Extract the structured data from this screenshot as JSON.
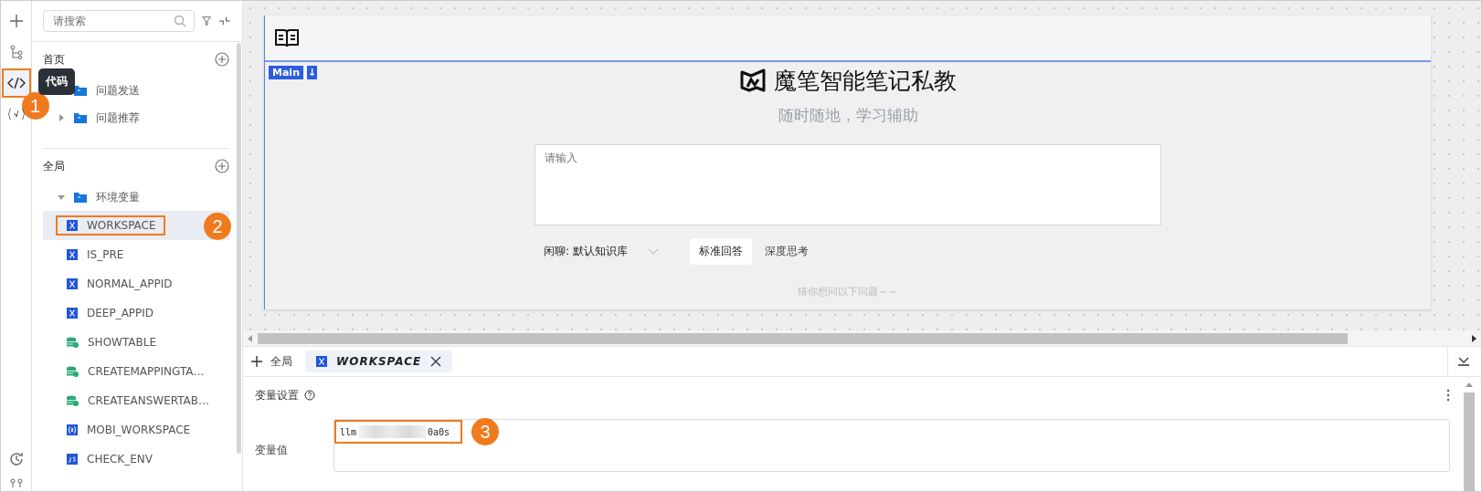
{
  "rail": {
    "items": [
      {
        "kind": "plus",
        "selected": false
      },
      {
        "kind": "tree",
        "selected": false
      },
      {
        "kind": "code",
        "selected": true,
        "callout": "1"
      },
      {
        "kind": "var",
        "selected": false
      }
    ],
    "bottom": [
      {
        "kind": "history"
      },
      {
        "kind": "branch"
      }
    ],
    "tooltip": "代码"
  },
  "sidebar": {
    "search": {
      "placeholder": "请搜索"
    },
    "sections": [
      {
        "title": "首页",
        "items": [
          {
            "label": "问题发送",
            "expanded": false
          },
          {
            "label": "问题推荐",
            "expanded": false
          }
        ]
      },
      {
        "title": "全局",
        "items": [
          {
            "label": "环境变量",
            "expanded": true,
            "children": [
              {
                "label": "WORKSPACE",
                "kind": "var",
                "selected": true,
                "callout": "2"
              },
              {
                "label": "IS_PRE",
                "kind": "var",
                "selected": false
              },
              {
                "label": "NORMAL_APPID",
                "kind": "var",
                "selected": false
              },
              {
                "label": "DEEP_APPID",
                "kind": "var",
                "selected": false
              },
              {
                "label": "SHOWTABLE",
                "kind": "db",
                "selected": false
              },
              {
                "label": "CREATEMAPPINGTA…",
                "kind": "db",
                "selected": false
              },
              {
                "label": "CREATEANSWERTAB…",
                "kind": "db",
                "selected": false
              },
              {
                "label": "MOBI_WORKSPACE",
                "kind": "func",
                "selected": false
              },
              {
                "label": "CHECK_ENV",
                "kind": "js",
                "selected": false
              }
            ]
          }
        ]
      }
    ]
  },
  "preview": {
    "main_badge": "Main",
    "main_arrow": "↓",
    "title": "魔笔智能笔记私教",
    "subtitle": "随时随地，学习辅助",
    "input": {
      "placeholder": "请输入"
    },
    "dropdown": "闲聊: 默认知识库",
    "modes": [
      {
        "label": "标准回答",
        "selected": true
      },
      {
        "label": "深度思考",
        "selected": false
      }
    ],
    "hint": "猜你想问以下问题～～"
  },
  "bottom_panel": {
    "scope": "全局",
    "tabs": [
      {
        "label": "WORKSPACE",
        "selected": true
      }
    ],
    "section_title": "变量设置",
    "field_label": "变量值",
    "value_start": "llm",
    "value_end": "0a0s",
    "callout": "3"
  }
}
